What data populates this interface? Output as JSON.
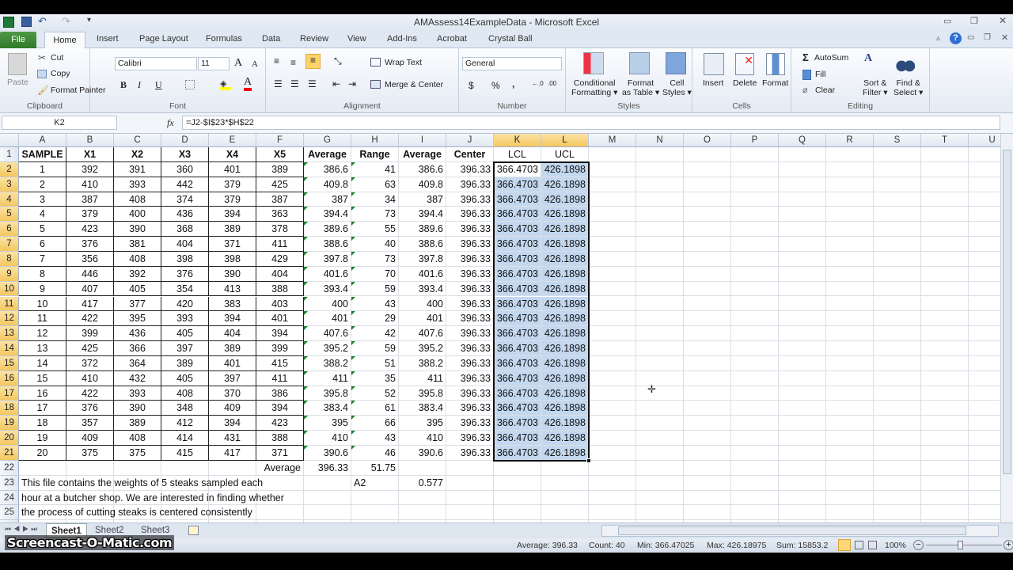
{
  "window": {
    "title": "AMAssess14ExampleData - Microsoft Excel"
  },
  "tabs": {
    "file": "File",
    "home": "Home",
    "others": [
      "Insert",
      "Page Layout",
      "Formulas",
      "Data",
      "Review",
      "View",
      "Add-Ins",
      "Acrobat",
      "Crystal Ball"
    ]
  },
  "ribbon": {
    "clipboard": {
      "label": "Clipboard",
      "paste": "Paste",
      "cut": "Cut",
      "copy": "Copy",
      "format_painter": "Format Painter"
    },
    "font": {
      "label": "Font",
      "font_name": "Calibri",
      "font_size": "11",
      "bold": "B",
      "italic": "I",
      "underline": "U",
      "font_color_glyph": "A"
    },
    "alignment": {
      "label": "Alignment",
      "wrap_text": "Wrap Text",
      "merge_center": "Merge & Center"
    },
    "number": {
      "label": "Number",
      "format": "General",
      "currency": "$",
      "percent": "%",
      "comma": ","
    },
    "styles": {
      "label": "Styles",
      "conditional": [
        "Conditional",
        "Formatting"
      ],
      "format_table": [
        "Format",
        "as Table"
      ],
      "cell_styles": [
        "Cell",
        "Styles"
      ]
    },
    "cells": {
      "label": "Cells",
      "insert": "Insert",
      "delete": "Delete",
      "format": "Format"
    },
    "editing": {
      "label": "Editing",
      "autosum": "AutoSum",
      "fill": "Fill",
      "clear": "Clear",
      "sort_filter": [
        "Sort &",
        "Filter"
      ],
      "find_select": [
        "Find &",
        "Select"
      ]
    }
  },
  "formula_bar": {
    "name_box": "K2",
    "fx": "fx",
    "formula": "=J2-$I$23*$H$22"
  },
  "sheet": {
    "columns": [
      "A",
      "B",
      "C",
      "D",
      "E",
      "F",
      "G",
      "H",
      "I",
      "J",
      "K",
      "L",
      "M",
      "N",
      "O",
      "P",
      "Q",
      "R",
      "S",
      "T",
      "U"
    ],
    "header_row": [
      "SAMPLE",
      "X1",
      "X2",
      "X3",
      "X4",
      "X5",
      "Average",
      "Range",
      "Average",
      "Center",
      "LCL",
      "UCL"
    ],
    "rows": [
      [
        "1",
        "392",
        "391",
        "360",
        "401",
        "389",
        "386.6",
        "41",
        "386.6",
        "396.33",
        "366.4703",
        "426.1898"
      ],
      [
        "2",
        "410",
        "393",
        "442",
        "379",
        "425",
        "409.8",
        "63",
        "409.8",
        "396.33",
        "366.4703",
        "426.1898"
      ],
      [
        "3",
        "387",
        "408",
        "374",
        "379",
        "387",
        "387",
        "34",
        "387",
        "396.33",
        "366.4703",
        "426.1898"
      ],
      [
        "4",
        "379",
        "400",
        "436",
        "394",
        "363",
        "394.4",
        "73",
        "394.4",
        "396.33",
        "366.4703",
        "426.1898"
      ],
      [
        "5",
        "423",
        "390",
        "368",
        "389",
        "378",
        "389.6",
        "55",
        "389.6",
        "396.33",
        "366.4703",
        "426.1898"
      ],
      [
        "6",
        "376",
        "381",
        "404",
        "371",
        "411",
        "388.6",
        "40",
        "388.6",
        "396.33",
        "366.4703",
        "426.1898"
      ],
      [
        "7",
        "356",
        "408",
        "398",
        "398",
        "429",
        "397.8",
        "73",
        "397.8",
        "396.33",
        "366.4703",
        "426.1898"
      ],
      [
        "8",
        "446",
        "392",
        "376",
        "390",
        "404",
        "401.6",
        "70",
        "401.6",
        "396.33",
        "366.4703",
        "426.1898"
      ],
      [
        "9",
        "407",
        "405",
        "354",
        "413",
        "388",
        "393.4",
        "59",
        "393.4",
        "396.33",
        "366.4703",
        "426.1898"
      ],
      [
        "10",
        "417",
        "377",
        "420",
        "383",
        "403",
        "400",
        "43",
        "400",
        "396.33",
        "366.4703",
        "426.1898"
      ],
      [
        "11",
        "422",
        "395",
        "393",
        "394",
        "401",
        "401",
        "29",
        "401",
        "396.33",
        "366.4703",
        "426.1898"
      ],
      [
        "12",
        "399",
        "436",
        "405",
        "404",
        "394",
        "407.6",
        "42",
        "407.6",
        "396.33",
        "366.4703",
        "426.1898"
      ],
      [
        "13",
        "425",
        "366",
        "397",
        "389",
        "399",
        "395.2",
        "59",
        "395.2",
        "396.33",
        "366.4703",
        "426.1898"
      ],
      [
        "14",
        "372",
        "364",
        "389",
        "401",
        "415",
        "388.2",
        "51",
        "388.2",
        "396.33",
        "366.4703",
        "426.1898"
      ],
      [
        "15",
        "410",
        "432",
        "405",
        "397",
        "411",
        "411",
        "35",
        "411",
        "396.33",
        "366.4703",
        "426.1898"
      ],
      [
        "16",
        "422",
        "393",
        "408",
        "370",
        "386",
        "395.8",
        "52",
        "395.8",
        "396.33",
        "366.4703",
        "426.1898"
      ],
      [
        "17",
        "376",
        "390",
        "348",
        "409",
        "394",
        "383.4",
        "61",
        "383.4",
        "396.33",
        "366.4703",
        "426.1898"
      ],
      [
        "18",
        "357",
        "389",
        "412",
        "394",
        "423",
        "395",
        "66",
        "395",
        "396.33",
        "366.4703",
        "426.1898"
      ],
      [
        "19",
        "409",
        "408",
        "414",
        "431",
        "388",
        "410",
        "43",
        "410",
        "396.33",
        "366.4703",
        "426.1898"
      ],
      [
        "20",
        "375",
        "375",
        "415",
        "417",
        "371",
        "390.6",
        "46",
        "390.6",
        "396.33",
        "366.4703",
        "426.1898"
      ]
    ],
    "row22": {
      "label": "Average",
      "avg": "396.33",
      "range": "51.75"
    },
    "row23": {
      "a2_label": "A2",
      "a2_value": "0.577"
    },
    "notes": [
      "This file contains the weights of 5 steaks sampled each",
      "hour at a butcher shop.  We are interested in finding whether",
      "the process of cutting steaks is centered consistently"
    ]
  },
  "sheet_tabs": [
    "Sheet1",
    "Sheet2",
    "Sheet3"
  ],
  "status": {
    "average": "Average: 396.33",
    "count": "Count: 40",
    "min": "Min: 366.47025",
    "max": "Max: 426.18975",
    "sum": "Sum: 15853.2",
    "zoom": "100%"
  },
  "watermark": "Screencast-O-Matic.com",
  "colors": {
    "selection": "#c3d8ef",
    "header_highlight": "#f5c75f",
    "file_tab": "#3a8a33"
  }
}
